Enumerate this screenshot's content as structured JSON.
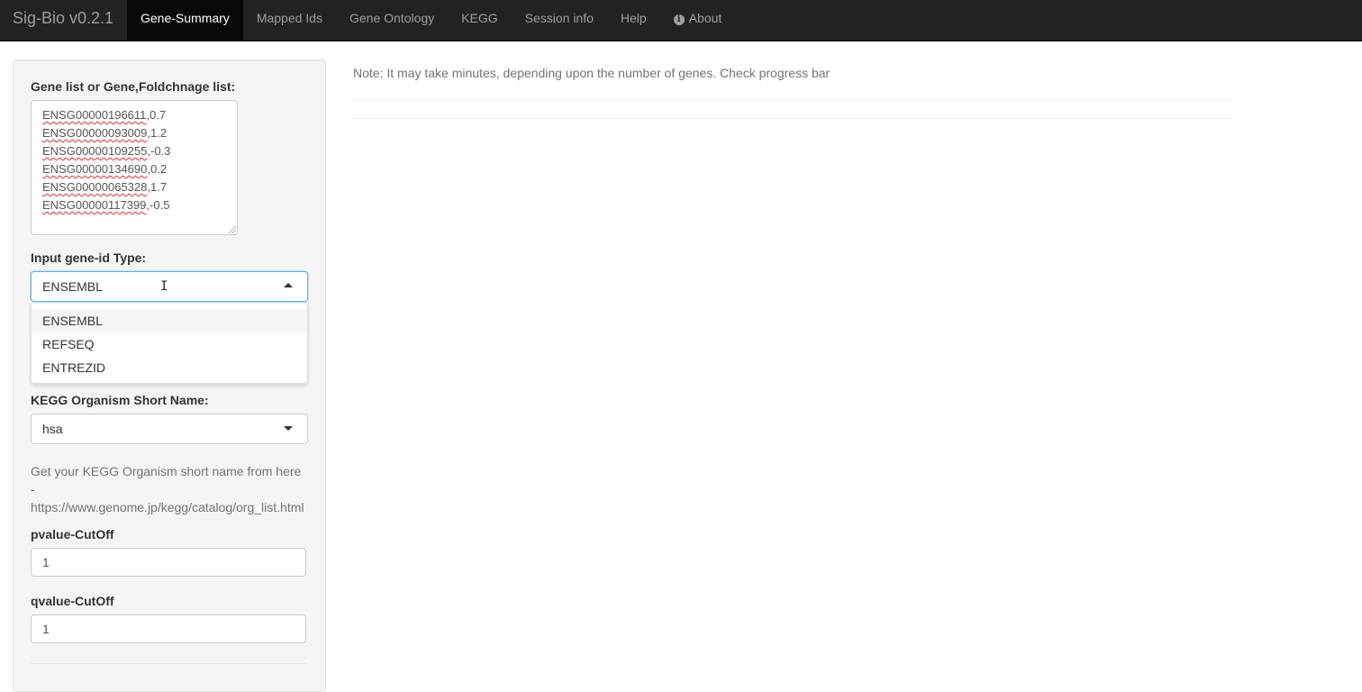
{
  "navbar": {
    "brand": "Sig-Bio v0.2.1",
    "tabs": [
      {
        "label": "Gene-Summary"
      },
      {
        "label": "Mapped Ids"
      },
      {
        "label": "Gene Ontology"
      },
      {
        "label": "KEGG"
      },
      {
        "label": "Session info"
      },
      {
        "label": "Help"
      },
      {
        "label": "About",
        "icon": "info-circle-icon"
      }
    ],
    "active_tab": "Gene-Summary"
  },
  "sidebar": {
    "gene_list_label": "Gene list or Gene,Foldchnage list:",
    "gene_list": [
      {
        "id": "ENSG00000196611",
        "fc": ",0.7"
      },
      {
        "id": "ENSG00000093009",
        "fc": ",1.2"
      },
      {
        "id": "ENSG00000109255",
        "fc": ",-0.3"
      },
      {
        "id": "ENSG00000134690",
        "fc": ",0.2"
      },
      {
        "id": "ENSG00000065328",
        "fc": ",1.7"
      },
      {
        "id": "ENSG00000117399",
        "fc": ",-0.5"
      }
    ],
    "gene_id_type_label": "Input gene-id Type:",
    "gene_id_type_value": "ENSEMBL",
    "gene_id_type_options": [
      "ENSEMBL",
      "REFSEQ",
      "ENTREZID"
    ],
    "kegg_label": "KEGG Organism Short Name:",
    "kegg_value": "hsa",
    "kegg_help": "Get your KEGG Organism short name from here - https://www.genome.jp/kegg/catalog/org_list.html",
    "pvalue_label": "pvalue-CutOff",
    "pvalue_value": "1",
    "qvalue_label": "qvalue-CutOff",
    "qvalue_value": "1"
  },
  "main": {
    "note": "Note: It may take minutes, depending upon the number of genes. Check progress bar"
  }
}
